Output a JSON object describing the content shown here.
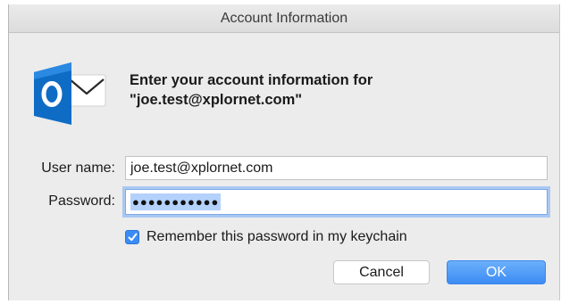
{
  "dialog": {
    "title": "Account Information",
    "message_line1": "Enter your account information for",
    "message_line2": "\"joe.test@xplornet.com\"",
    "username_label": "User name:",
    "username_value": "joe.test@xplornet.com",
    "password_label": "Password:",
    "password_mask": "●●●●●●●●●●●",
    "remember_label": "Remember this password in my keychain",
    "remember_checked": true,
    "cancel_label": "Cancel",
    "ok_label": "OK"
  },
  "icons": {
    "app": "outlook-icon",
    "checkmark": "checkmark-icon"
  },
  "colors": {
    "accent": "#3d8cf5",
    "outlook_blue": "#0f6cc5",
    "focus_ring": "#a9c8f2"
  }
}
